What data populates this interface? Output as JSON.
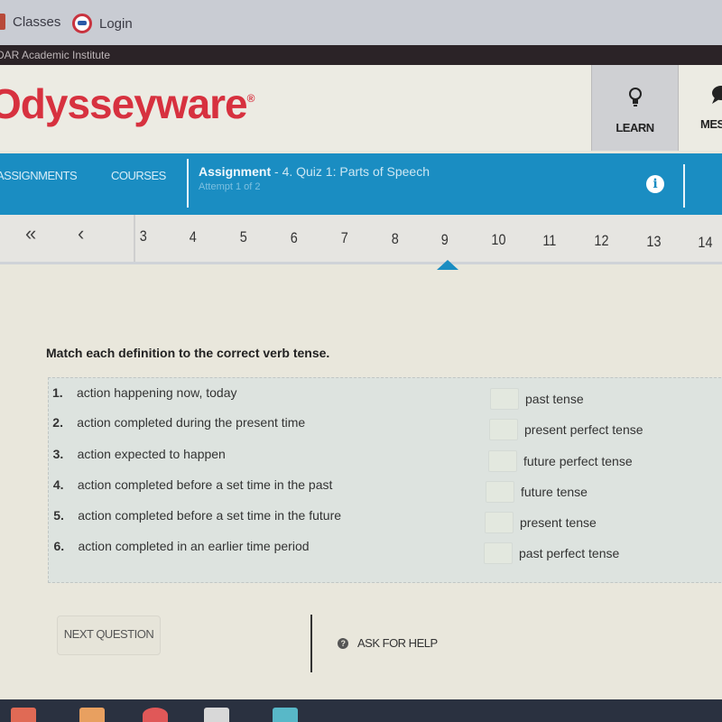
{
  "bookmarks": [
    {
      "label": "Classes",
      "icon": "classes-icon"
    },
    {
      "label": "Login",
      "icon": "login-icon"
    }
  ],
  "institute_name": "DAR Academic Institute",
  "brand": {
    "name": "Odysseyware",
    "mark": "®",
    "color": "#d7313f"
  },
  "header_nav": [
    {
      "label": "LEARN",
      "icon": "lightbulb-icon",
      "active": true
    },
    {
      "label": "MES",
      "icon": "message-icon",
      "active": false
    }
  ],
  "nav": {
    "tabs": [
      "ASSIGNMENTS",
      "COURSES"
    ],
    "assignment_label": "Assignment",
    "assignment_title": "- 4. Quiz 1: Parts of Speech",
    "attempt": "Attempt 1 of 2",
    "info_icon": "i",
    "bar_color": "#1a8dc2"
  },
  "pager": {
    "first_label": "«",
    "prev_label": "‹",
    "pages": [
      "3",
      "4",
      "5",
      "6",
      "7",
      "8",
      "9",
      "10",
      "11",
      "12",
      "13",
      "14"
    ],
    "current": "9"
  },
  "question": {
    "prompt": "Match each definition to the correct verb tense.",
    "definitions": [
      {
        "num": "1.",
        "text": "action happening now, today"
      },
      {
        "num": "2.",
        "text": "action completed during the present time"
      },
      {
        "num": "3.",
        "text": "action expected to happen"
      },
      {
        "num": "4.",
        "text": "action completed before a set time in the past"
      },
      {
        "num": "5.",
        "text": "action completed before a set time in the future"
      },
      {
        "num": "6.",
        "text": "action completed in an earlier time period"
      }
    ],
    "choices": [
      "past tense",
      "present perfect tense",
      "future perfect tense",
      "future tense",
      "present tense",
      "past perfect tense"
    ]
  },
  "footer": {
    "next_label": "NEXT QUESTION",
    "help_label": "ASK FOR HELP",
    "help_icon": "?"
  }
}
